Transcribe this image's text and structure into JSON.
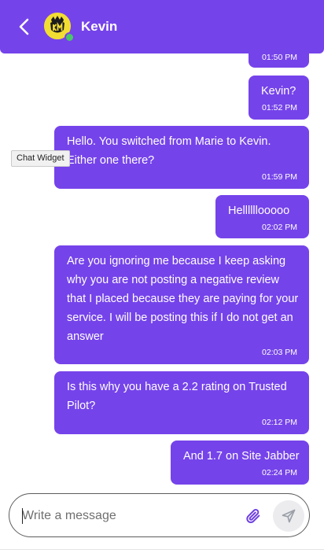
{
  "header": {
    "agent_name": "Kevin",
    "avatar_alt": "KM",
    "status": "online",
    "back_icon": "chevron-left-icon"
  },
  "tooltip": {
    "text": "Chat Widget"
  },
  "messages": [
    {
      "text": "",
      "time": "01:50 PM"
    },
    {
      "text": "Kevin?",
      "time": "01:52 PM"
    },
    {
      "text": "Hello. You switched from Marie to Kevin. Either one there?",
      "time": "01:59 PM"
    },
    {
      "text": "Hellllllooooo",
      "time": "02:02 PM"
    },
    {
      "text": "Are you ignoring me because I keep asking why you are not posting a negative review that I placed because they are paying for your service. I will be posting this if I do not get an answer",
      "time": "02:03 PM"
    },
    {
      "text": "Is this why you have a 2.2 rating on Trusted Pilot?",
      "time": "02:12 PM"
    },
    {
      "text": "And 1.7 on Site Jabber",
      "time": "02:24 PM"
    }
  ],
  "composer": {
    "placeholder": "Write a message",
    "value": "",
    "attach_icon": "paperclip-icon",
    "send_icon": "send-icon"
  },
  "colors": {
    "brand": "#7543ea",
    "bubble_text": "#ffffff",
    "online": "#49c56a",
    "avatar_bg": "#f2dd33"
  }
}
